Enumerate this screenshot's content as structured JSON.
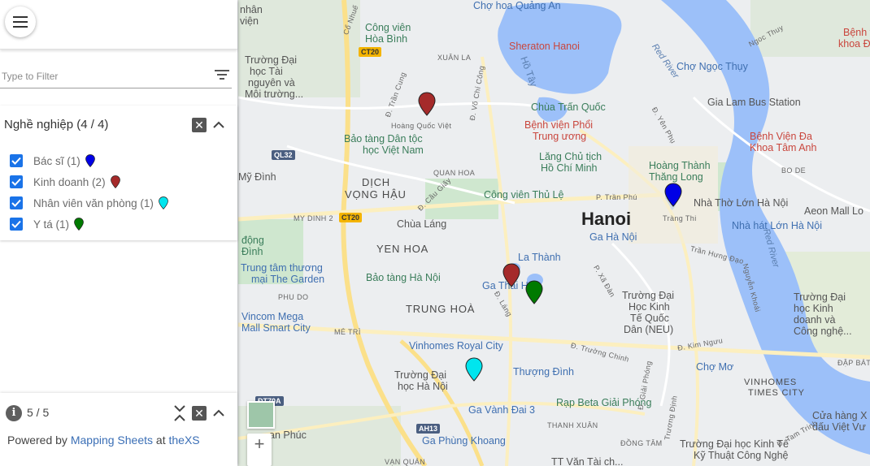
{
  "sidebar": {
    "filter": {
      "placeholder": "Type to Filter"
    },
    "group": {
      "title": "Nghề nghiệp (4 / 4)",
      "items": [
        {
          "label": "Bác sĩ (1)",
          "pin_color": "#0000e6",
          "checked": true
        },
        {
          "label": "Kinh doanh (2)",
          "pin_color": "#a52a2a",
          "checked": true
        },
        {
          "label": "Nhân viên văn phòng (1)",
          "pin_color": "#00e5ee",
          "checked": true
        },
        {
          "label": "Y tá (1)",
          "pin_color": "#007a00",
          "checked": true
        }
      ]
    },
    "footer": {
      "count": "5 / 5",
      "powered_prefix": "Powered by ",
      "link_mapping": "Mapping Sheets",
      "at_word": " at ",
      "link_thexs": "theXS"
    }
  },
  "map": {
    "city": "Hanoi",
    "districts": {
      "dich_vong_hau_1": "DỊCH",
      "dich_vong_hau_2": "VỌNG HẬU",
      "yen_hoa": "YEN HOA",
      "trung_hoa": "TRUNG HOÀ",
      "vinhomes_times_city_1": "VINHOMES",
      "vinhomes_times_city_2": "TIMES CITY"
    },
    "labels": {
      "cho_hoa": "Chợ hoa Quảng An",
      "sheraton": "Sheraton Hanoi",
      "ho_tay": "Hồ Tây",
      "red_river": "Red River",
      "red_river2": "Red River",
      "cho_ngoc_thuy": "Chợ Ngọc Thụy",
      "gia_lam": "Gia Lam Bus Station",
      "chua_tran_quoc": "Chùa Trấn Quốc",
      "bv_phoi_1": "Bệnh viện Phổi",
      "bv_phoi_2": "Trung ương",
      "lang_1": "Lăng Chủ tịch",
      "lang_2": "Hồ Chí Minh",
      "hoang_thanh_1": "Hoàng Thành",
      "hoang_thanh_2": "Thăng Long",
      "bv_tam_anh_1": "Bệnh Viện Đa",
      "bv_tam_anh_2": "Khoa Tâm Anh",
      "nha_tho": "Nhà Thờ Lớn Hà Nội",
      "aeon": "Aeon Mall Lo",
      "nha_hat": "Nhà hát Lớn Hà Nội",
      "bao_tang_dan_toc_1": "Bảo tàng Dân tộc",
      "bao_tang_dan_toc_2": "học Việt Nam",
      "cong_vien_thu_le": "Công viên Thủ Lệ",
      "chua_lang": "Chùa Láng",
      "ga_ha_noi": "Ga Hà Nội",
      "la_thanh": "La Thành",
      "ga_thai_ha": "Ga Thái Hà",
      "bao_tang_ha_noi": "Bảo tàng Hà Nội",
      "trung_tam_1": "Trung tâm thương",
      "trung_tam_2": "mại The Garden",
      "vincom_1": "Vincom Mega",
      "vincom_2": "Mall Smart City",
      "vinhomes_royal": "Vinhomes Royal City",
      "thuong_dinh": "Thượng Đình",
      "ga_vanh_dai": "Ga Vành Đai 3",
      "rap_beta": "Rạp Beta Giải Phóng",
      "ga_phung_khoang": "Ga Phùng Khoang",
      "dh_ha_noi_1": "Trường Đại",
      "dh_ha_noi_2": "học Hà Nội",
      "dh_ktqd_1": "Trường Đại",
      "dh_ktqd_2": "Học Kinh",
      "dh_ktqd_3": "Tế Quốc",
      "dh_ktqd_4": "Dân (NEU)",
      "cho_mo": "Chợ Mơ",
      "dh_kinh_doanh_1": "Trường Đại",
      "dh_kinh_doanh_2": "học Kinh",
      "dh_kinh_doanh_3": "doanh và",
      "dh_kinh_doanh_4": "Công nghệ...",
      "dh_kt_cong_nghe": "Trường Đại học Kinh Tế",
      "dh_kt_cong_nghe_2": "Kỹ Thuật Công Nghệ",
      "cua_hang_1": "Cửa hàng X",
      "cua_hang_2": "dấu Việt Vư",
      "benh_vien_k_1": "Bệnh vi",
      "benh_vien_k_2": "khoa Đức",
      "cong_vien_hoa_binh_1": "Công viên",
      "cong_vien_hoa_binh_2": "Hòa Bình",
      "dh_tai_nguyen_1": "Trường Đại",
      "dh_tai_nguyen_2": "học Tài",
      "dh_tai_nguyen_3": "nguyên và",
      "dh_tai_nguyen_4": "Môi trường...",
      "my_dinh": "Mỹ Đình",
      "dong_1": "động",
      "dong_2": "Đình",
      "nhan": "nhân",
      "vien_nhan": "viện",
      "an_phuc": "an Phúc",
      "tt_van": "TT Văn Tài ch..."
    },
    "streets": {
      "xuan_la": "XUÂN LA",
      "hoang_quoc_viet": "Hoàng Quốc Việt",
      "quan_hoa": "QUAN HOA",
      "my_dinh_2": "MY DINH 2",
      "phu_do": "PHU DO",
      "me_tri": "MÉ TRÌ",
      "d_tran_phu": "P. Trần Phú",
      "trang_thi": "Tràng Thi",
      "tran_hung_dao": "Trần Hưng Đạo",
      "bo_de": "BO DE",
      "ngoc_thuy": "Ngoc Thuy",
      "d_yen_phu": "Đ. Yên Phụ",
      "d_truong_chinh": "Đ. Trường Chinh",
      "d_kim_nguu": "Đ. Kim Ngưu",
      "d_giai_phong": "Đ. Giải Phóng",
      "d_vo_chi_cong": "Đ. Võ Chí Công",
      "d_cau_giay": "Đ. Cầu Giấy",
      "tran_cung": "Đ. Trần Cung",
      "co_nhue": "Cổ Nhuế",
      "d_lang": "Đ. Láng",
      "xa_dan": "P. Xã Đàn",
      "nguyen_khoai": "Nguyễn Khoái",
      "truong_dinh": "Trương Định",
      "d_tam_trinh": "Đ. Tam Trinh",
      "dap_bat": "ĐẬP BÁT",
      "bo_de_2": "ĐỒNG TÂM",
      "van_quan": "VẠN QUÁN",
      "thanh_xuan": "THANH XUÂN"
    },
    "shields": {
      "ct20_a": "CT20",
      "ct20_b": "CT20",
      "ql32": "QL32",
      "ah13": "AH13",
      "dt70a": "ĐT70A"
    },
    "zoom_in": "+",
    "markers": [
      {
        "category": "Kinh doanh",
        "color": "#a52a2a"
      },
      {
        "category": "Bác sĩ",
        "color": "#0000e6"
      },
      {
        "category": "Kinh doanh",
        "color": "#a52a2a"
      },
      {
        "category": "Y tá",
        "color": "#007a00"
      },
      {
        "category": "Nhân viên văn phòng",
        "color": "#00e5ee"
      }
    ]
  }
}
